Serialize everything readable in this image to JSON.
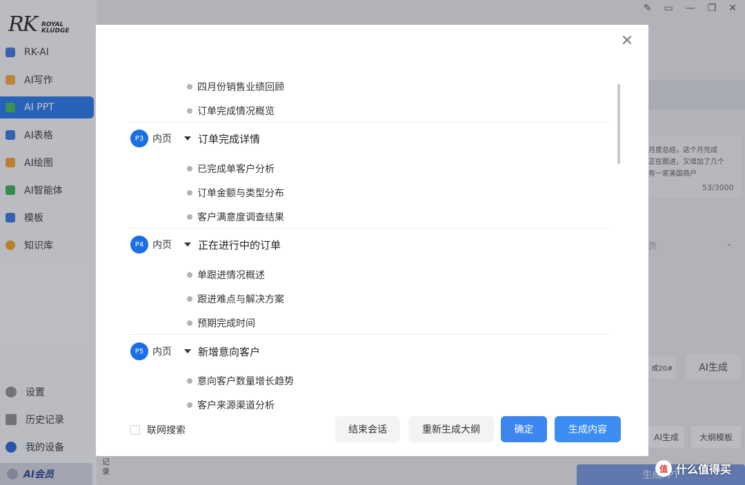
{
  "sidebar": {
    "logo_rk": "RK",
    "logo_brand_line1": "ROYAL",
    "logo_brand_line2": "KLUDGE",
    "items": [
      {
        "label": "RK-AI",
        "icon": "rk-ai-icon",
        "color": "#3a6fd8"
      },
      {
        "label": "AI写作",
        "icon": "ai-writing-icon",
        "color": "#e8a33a"
      },
      {
        "label": "AI PPT",
        "icon": "ai-ppt-icon",
        "color": "#3bb25a"
      },
      {
        "label": "AI表格",
        "icon": "ai-table-icon",
        "color": "#2f6fd6"
      },
      {
        "label": "AI绘图",
        "icon": "ai-drawing-icon",
        "color": "#e89a2a"
      },
      {
        "label": "AI智能体",
        "icon": "ai-agent-icon",
        "color": "#36a852"
      },
      {
        "label": "模板",
        "icon": "template-icon",
        "color": "#2f6fd6"
      },
      {
        "label": "知识库",
        "icon": "knowledge-base-icon",
        "color": "#e0a020"
      }
    ],
    "bottom": [
      {
        "label": "设置",
        "icon": "gear-icon",
        "color": "#777777"
      },
      {
        "label": "历史记录",
        "icon": "history-icon",
        "color": "#777777"
      },
      {
        "label": "我的设备",
        "icon": "device-icon",
        "color": "#1f5fd0"
      }
    ],
    "vip_label": "AI会员"
  },
  "background": {
    "right_text": "月度总结，这个月完成\n正在跟进，又增加了几个\n有一家美国商户",
    "char_count": "53/3000",
    "select_value": "页",
    "btn_ai_gen": "AI生成",
    "btn_count_label": "成20#",
    "btn_ai_gen_small": "AI生成",
    "btn_outline_template": "大纲模板",
    "gen_ppt": "生成PPT",
    "record_label": "记录",
    "watermark_icon": "值",
    "watermark": "什么值得买"
  },
  "modal": {
    "sections": [
      {
        "badge": null,
        "type": null,
        "title": null,
        "items": [
          "四月份销售业绩回顾",
          "订单完成情况概览"
        ]
      },
      {
        "badge": "P3",
        "type": "内页",
        "title": "订单完成详情",
        "items": [
          "已完成单客户分析",
          "订单金额与类型分布",
          "客户满意度调查结果"
        ]
      },
      {
        "badge": "P4",
        "type": "内页",
        "title": "正在进行中的订单",
        "items": [
          "单跟进情况概述",
          "跟进难点与解决方案",
          "预期完成时间"
        ]
      },
      {
        "badge": "P5",
        "type": "内页",
        "title": "新增意向客户",
        "items": [
          "意向客户数量增长趋势",
          "客户来源渠道分析"
        ]
      }
    ],
    "web_search_label": "联网搜索",
    "buttons": {
      "end_session": "结束会话",
      "regenerate": "重新生成大纲",
      "confirm": "确定",
      "generate": "生成内容"
    }
  }
}
